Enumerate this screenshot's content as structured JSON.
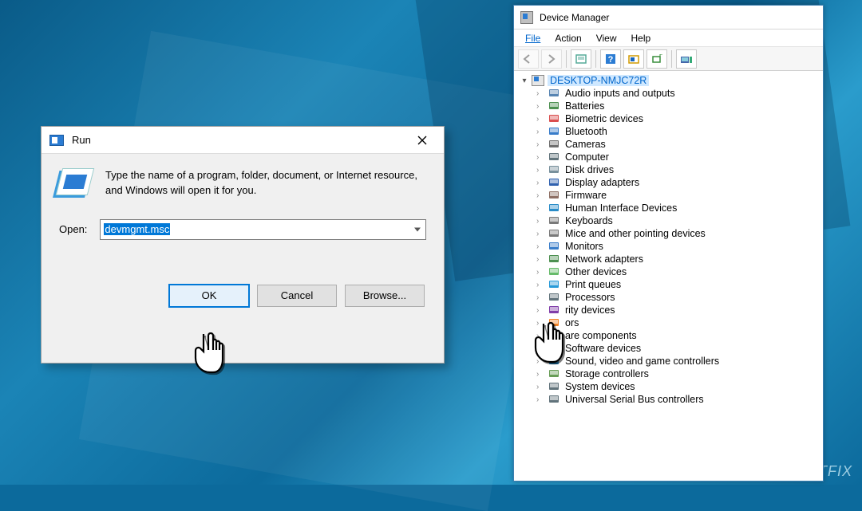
{
  "watermark": "UGETFIX",
  "run": {
    "title": "Run",
    "desc": "Type the name of a program, folder, document, or Internet resource, and Windows will open it for you.",
    "open_label": "Open:",
    "input_value": "devmgmt.msc",
    "buttons": {
      "ok": "OK",
      "cancel": "Cancel",
      "browse": "Browse..."
    }
  },
  "dm": {
    "title": "Device Manager",
    "menu": [
      "File",
      "Action",
      "View",
      "Help"
    ],
    "root": "DESKTOP-NMJC72R",
    "items": [
      {
        "label": "Audio inputs and outputs",
        "icon": "audio",
        "color": "#3a6ea5"
      },
      {
        "label": "Batteries",
        "icon": "battery",
        "color": "#2e7d32"
      },
      {
        "label": "Biometric devices",
        "icon": "biometric",
        "color": "#d32f2f"
      },
      {
        "label": "Bluetooth",
        "icon": "bluetooth",
        "color": "#1565c0"
      },
      {
        "label": "Cameras",
        "icon": "camera",
        "color": "#555"
      },
      {
        "label": "Computer",
        "icon": "computer",
        "color": "#455a64"
      },
      {
        "label": "Disk drives",
        "icon": "disk",
        "color": "#607d8b"
      },
      {
        "label": "Display adapters",
        "icon": "display",
        "color": "#0d47a1"
      },
      {
        "label": "Firmware",
        "icon": "firmware",
        "color": "#795548"
      },
      {
        "label": "Human Interface Devices",
        "icon": "hid",
        "color": "#0277bd"
      },
      {
        "label": "Keyboards",
        "icon": "keyboard",
        "color": "#616161"
      },
      {
        "label": "Mice and other pointing devices",
        "icon": "mouse",
        "color": "#616161"
      },
      {
        "label": "Monitors",
        "icon": "monitor",
        "color": "#1565c0"
      },
      {
        "label": "Network adapters",
        "icon": "network",
        "color": "#2e7d32"
      },
      {
        "label": "Other devices",
        "icon": "other",
        "color": "#4caf50"
      },
      {
        "label": "Print queues",
        "icon": "print",
        "color": "#0288d1"
      },
      {
        "label": "Processors",
        "icon": "cpu",
        "color": "#455a64"
      },
      {
        "label": "Security devices",
        "icon": "security",
        "color": "#6a1b9a",
        "obscured": "rity devices"
      },
      {
        "label": "Sensors",
        "icon": "sensor",
        "color": "#ef6c00",
        "obscured": "ors"
      },
      {
        "label": "Software components",
        "icon": "swcomp",
        "color": "#1976d2",
        "obscured": "are components"
      },
      {
        "label": "Software devices",
        "icon": "swdev",
        "color": "#1976d2"
      },
      {
        "label": "Sound, video and game controllers",
        "icon": "sound",
        "color": "#0277bd"
      },
      {
        "label": "Storage controllers",
        "icon": "storage",
        "color": "#4e8c3a"
      },
      {
        "label": "System devices",
        "icon": "system",
        "color": "#455a64"
      },
      {
        "label": "Universal Serial Bus controllers",
        "icon": "usb",
        "color": "#455a64"
      }
    ]
  }
}
